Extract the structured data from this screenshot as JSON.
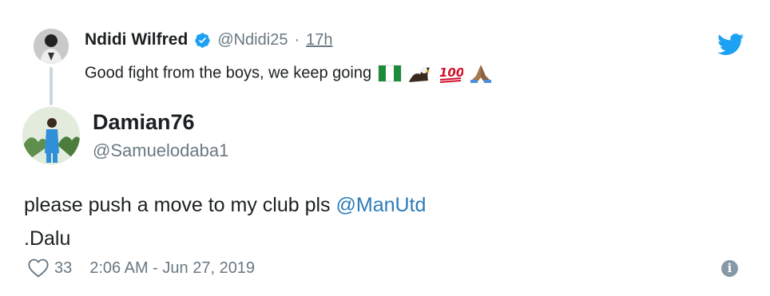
{
  "parent_tweet": {
    "name": "Ndidi Wilfred",
    "handle": "@Ndidi25",
    "separator": "·",
    "time": "17h",
    "text": "Good fight from the boys, we keep going",
    "emojis": [
      "flag-nigeria-icon",
      "eagle-icon",
      "hundred-points-icon",
      "folded-hands-icon"
    ]
  },
  "tweet": {
    "name": "Damian76",
    "handle": "@Samuelodaba1",
    "text_before_mention": "please push a move to my club pls ",
    "mention": "@ManUtd",
    "text_line2": ".Dalu",
    "likes": "33",
    "datetime": "2:06 AM - Jun 27, 2019"
  },
  "colors": {
    "twitter_blue": "#1da1f2",
    "link": "#2b7bb9",
    "muted": "#697882",
    "thread_line": "#ccd6dd"
  }
}
